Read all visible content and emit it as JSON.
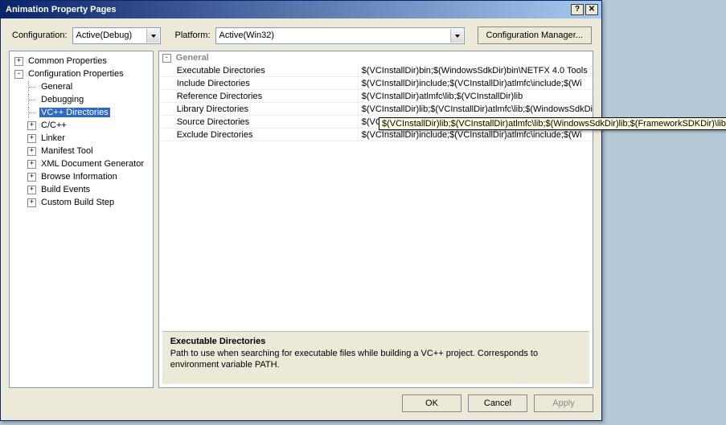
{
  "titlebar": {
    "title": "Animation Property Pages"
  },
  "config": {
    "config_label": "Configuration:",
    "config_value": "Active(Debug)",
    "platform_label": "Platform:",
    "platform_value": "Active(Win32)",
    "manager_button": "Configuration Manager..."
  },
  "tree": {
    "items": [
      {
        "level": 1,
        "expander": "+",
        "label": "Common Properties"
      },
      {
        "level": 1,
        "expander": "-",
        "label": "Configuration Properties"
      },
      {
        "level": 2,
        "expander": "",
        "label": "General"
      },
      {
        "level": 2,
        "expander": "",
        "label": "Debugging"
      },
      {
        "level": 2,
        "expander": "",
        "label": "VC++ Directories",
        "selected": true
      },
      {
        "level": 2,
        "expander": "+",
        "label": "C/C++"
      },
      {
        "level": 2,
        "expander": "+",
        "label": "Linker"
      },
      {
        "level": 2,
        "expander": "+",
        "label": "Manifest Tool"
      },
      {
        "level": 2,
        "expander": "+",
        "label": "XML Document Generator"
      },
      {
        "level": 2,
        "expander": "+",
        "label": "Browse Information"
      },
      {
        "level": 2,
        "expander": "+",
        "label": "Build Events"
      },
      {
        "level": 2,
        "expander": "+",
        "label": "Custom Build Step"
      }
    ]
  },
  "properties": {
    "group": "General",
    "rows": [
      {
        "name": "Executable Directories",
        "value": "$(VCInstallDir)bin;$(WindowsSdkDir)bin\\NETFX 4.0 Tools"
      },
      {
        "name": "Include Directories",
        "value": "$(VCInstallDir)include;$(VCInstallDir)atlmfc\\include;$(Wi"
      },
      {
        "name": "Reference Directories",
        "value": "$(VCInstallDir)atlmfc\\lib;$(VCInstallDir)lib"
      },
      {
        "name": "Library Directories",
        "value": "$(VCInstallDir)lib;$(VCInstallDir)atlmfc\\lib;$(WindowsSdkDi"
      },
      {
        "name": "Source Directories",
        "value": "$(VCInstallDir)atlmfc\\src\\mfc;$(VCInstallDir)atlmfc\\src\\m"
      },
      {
        "name": "Exclude Directories",
        "value": "$(VCInstallDir)include;$(VCInstallDir)atlmfc\\include;$(Wi"
      }
    ]
  },
  "tooltip": {
    "text": "$(VCInstallDir)lib;$(VCInstallDir)atlmfc\\lib;$(WindowsSdkDir)lib;$(FrameworkSDKDir)\\lib"
  },
  "description": {
    "title": "Executable Directories",
    "text": "Path to use when searching for executable files while building a VC++ project.  Corresponds to environment variable PATH."
  },
  "buttons": {
    "ok": "OK",
    "cancel": "Cancel",
    "apply": "Apply"
  }
}
